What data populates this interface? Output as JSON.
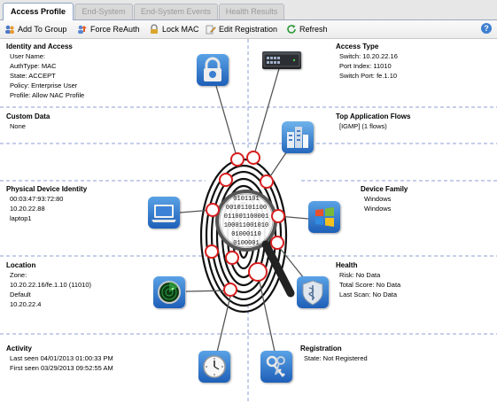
{
  "tabs": [
    {
      "label": "Access Profile",
      "active": true
    },
    {
      "label": "End-System",
      "active": false
    },
    {
      "label": "End-System Events",
      "active": false
    },
    {
      "label": "Health Results",
      "active": false
    }
  ],
  "toolbar": {
    "add_to_group": "Add To Group",
    "force_reauth": "Force ReAuth",
    "lock_mac": "Lock MAC",
    "edit_registration": "Edit Registration",
    "refresh": "Refresh"
  },
  "identity": {
    "title": "Identity and Access",
    "lines": [
      "User Name:",
      "AuthType: MAC",
      "State: ACCEPT",
      "Policy: Enterprise User",
      "Profile: Allow NAC Profile"
    ]
  },
  "custom_data": {
    "title": "Custom Data",
    "lines": [
      "None"
    ]
  },
  "physical": {
    "title": "Physical Device Identity",
    "lines": [
      "00:03:47:93:72:80",
      "10.20.22.88",
      "laptop1"
    ]
  },
  "location": {
    "title": "Location",
    "lines": [
      "Zone:",
      "10.20.22.16/fe.1.10 (11010)",
      "Default",
      "10.20.22.4"
    ]
  },
  "activity": {
    "title": "Activity",
    "lines": [
      "Last seen 04/01/2013 01:00:33 PM",
      "First seen 03/29/2013 09:52:55 AM"
    ]
  },
  "access_type": {
    "title": "Access Type",
    "lines": [
      "Switch: 10.20.22.16",
      "Port Index: 11010",
      "Switch Port: fe.1.10"
    ]
  },
  "app_flows": {
    "title": "Top Application Flows",
    "lines": [
      "[IGMP] (1 flows)"
    ]
  },
  "device_family": {
    "title": "Device Family",
    "lines": [
      "Windows",
      "Windows"
    ]
  },
  "health": {
    "title": "Health",
    "lines": [
      "Risk: No Data",
      "Total Score: No Data",
      "Last Scan: No Data"
    ]
  },
  "registration": {
    "title": "Registration",
    "lines": [
      "State: Not Registered"
    ]
  },
  "fingerprint_binary": [
    "0101101",
    "00101101100",
    "011001100001",
    "100011001010",
    "01000110",
    "0100001"
  ],
  "colors": {
    "accent": "#8e9fd6",
    "marker": "#d81e1e",
    "tab_border": "#8ea3c6"
  }
}
